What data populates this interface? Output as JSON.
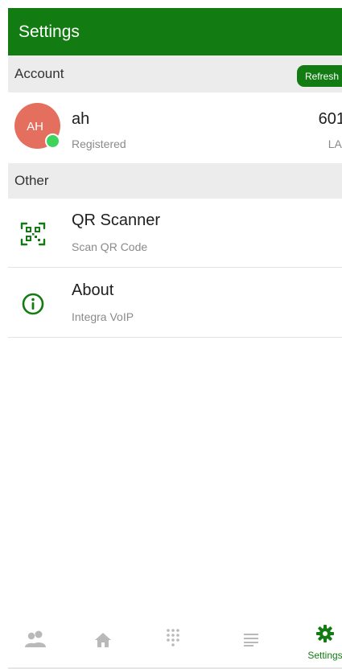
{
  "header": {
    "title": "Settings"
  },
  "sections": {
    "account_label": "Account",
    "refresh_label": "Refresh",
    "other_label": "Other"
  },
  "account": {
    "initials": "AH",
    "name": "ah",
    "status": "Registered",
    "right_value": "601",
    "right_sub": "LAN",
    "status_color": "#3ed35b"
  },
  "other_items": [
    {
      "title": "QR Scanner",
      "subtitle": "Scan QR Code",
      "icon": "qr-code-icon"
    },
    {
      "title": "About",
      "subtitle": "Integra VoIP",
      "icon": "info-icon"
    }
  ],
  "bottom_nav": {
    "items": [
      {
        "name": "contacts",
        "icon": "contacts-icon",
        "label": ""
      },
      {
        "name": "home",
        "icon": "home-icon",
        "label": ""
      },
      {
        "name": "dialpad",
        "icon": "dialpad-icon",
        "label": ""
      },
      {
        "name": "history",
        "icon": "list-icon",
        "label": ""
      },
      {
        "name": "settings",
        "icon": "gear-icon",
        "label": "Settings",
        "active": true
      }
    ]
  },
  "colors": {
    "brand_green": "#127c12",
    "avatar_bg": "#e56f5e",
    "section_bg": "#ececec",
    "inactive_icon": "#b9b9b9"
  }
}
